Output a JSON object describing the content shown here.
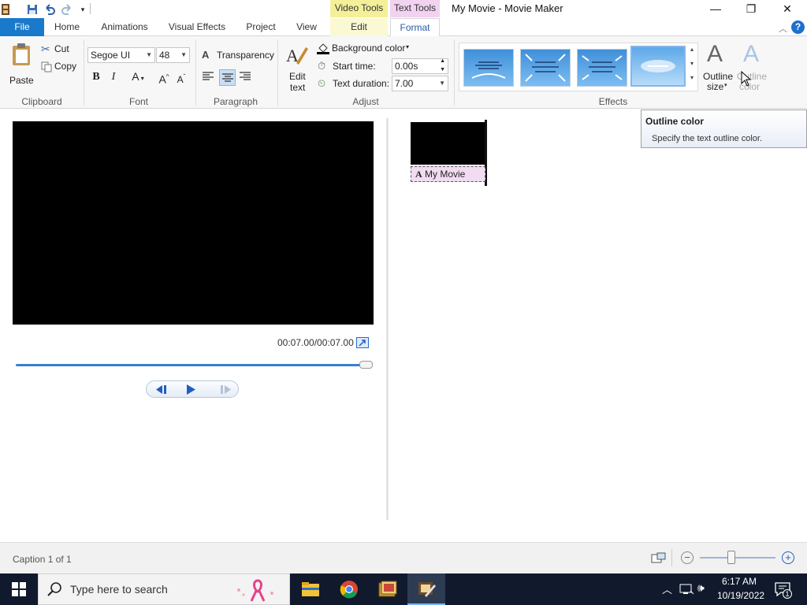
{
  "window": {
    "title": "My Movie - Movie Maker",
    "context_tabs": {
      "video_tools": "Video Tools",
      "text_tools": "Text Tools"
    },
    "controls": {
      "minimize": "—",
      "restore": "❐",
      "close": "✕"
    }
  },
  "tabs": [
    "File",
    "Home",
    "Animations",
    "Visual Effects",
    "Project",
    "View",
    "Edit",
    "Format"
  ],
  "help": "?",
  "ribbon": {
    "clipboard": {
      "paste": "Paste",
      "cut": "Cut",
      "copy": "Copy",
      "label": "Clipboard"
    },
    "font": {
      "family": "Segoe UI",
      "size": "48",
      "label": "Font"
    },
    "paragraph": {
      "transparency": "Transparency",
      "label": "Paragraph"
    },
    "adjust": {
      "edit_text_l1": "Edit",
      "edit_text_l2": "text",
      "background_color": "Background color",
      "start_time_label": "Start time:",
      "start_time_value": "0.00s",
      "text_duration_label": "Text duration:",
      "text_duration_value": "7.00",
      "label": "Adjust"
    },
    "effects": {
      "label": "Effects"
    },
    "outline": {
      "size_l1": "Outline",
      "size_l2": "size",
      "color_l1": "Outline",
      "color_l2": "color"
    }
  },
  "tooltip": {
    "title": "Outline color",
    "body": "Specify the text outline color."
  },
  "preview": {
    "time": "00:07.00/00:07.00",
    "progress": 1.0
  },
  "storyboard": {
    "caption": "My Movie"
  },
  "status": {
    "caption_count": "Caption 1 of 1"
  },
  "taskbar": {
    "search_placeholder": "Type here to search",
    "time": "6:17 AM",
    "date": "10/19/2022",
    "notification_count": "1"
  },
  "colors": {
    "accent": "#1979ca",
    "text_tools_tab": "#f1d2f0",
    "video_tools_tab": "#f4f09a",
    "taskbar": "#101a2c"
  }
}
